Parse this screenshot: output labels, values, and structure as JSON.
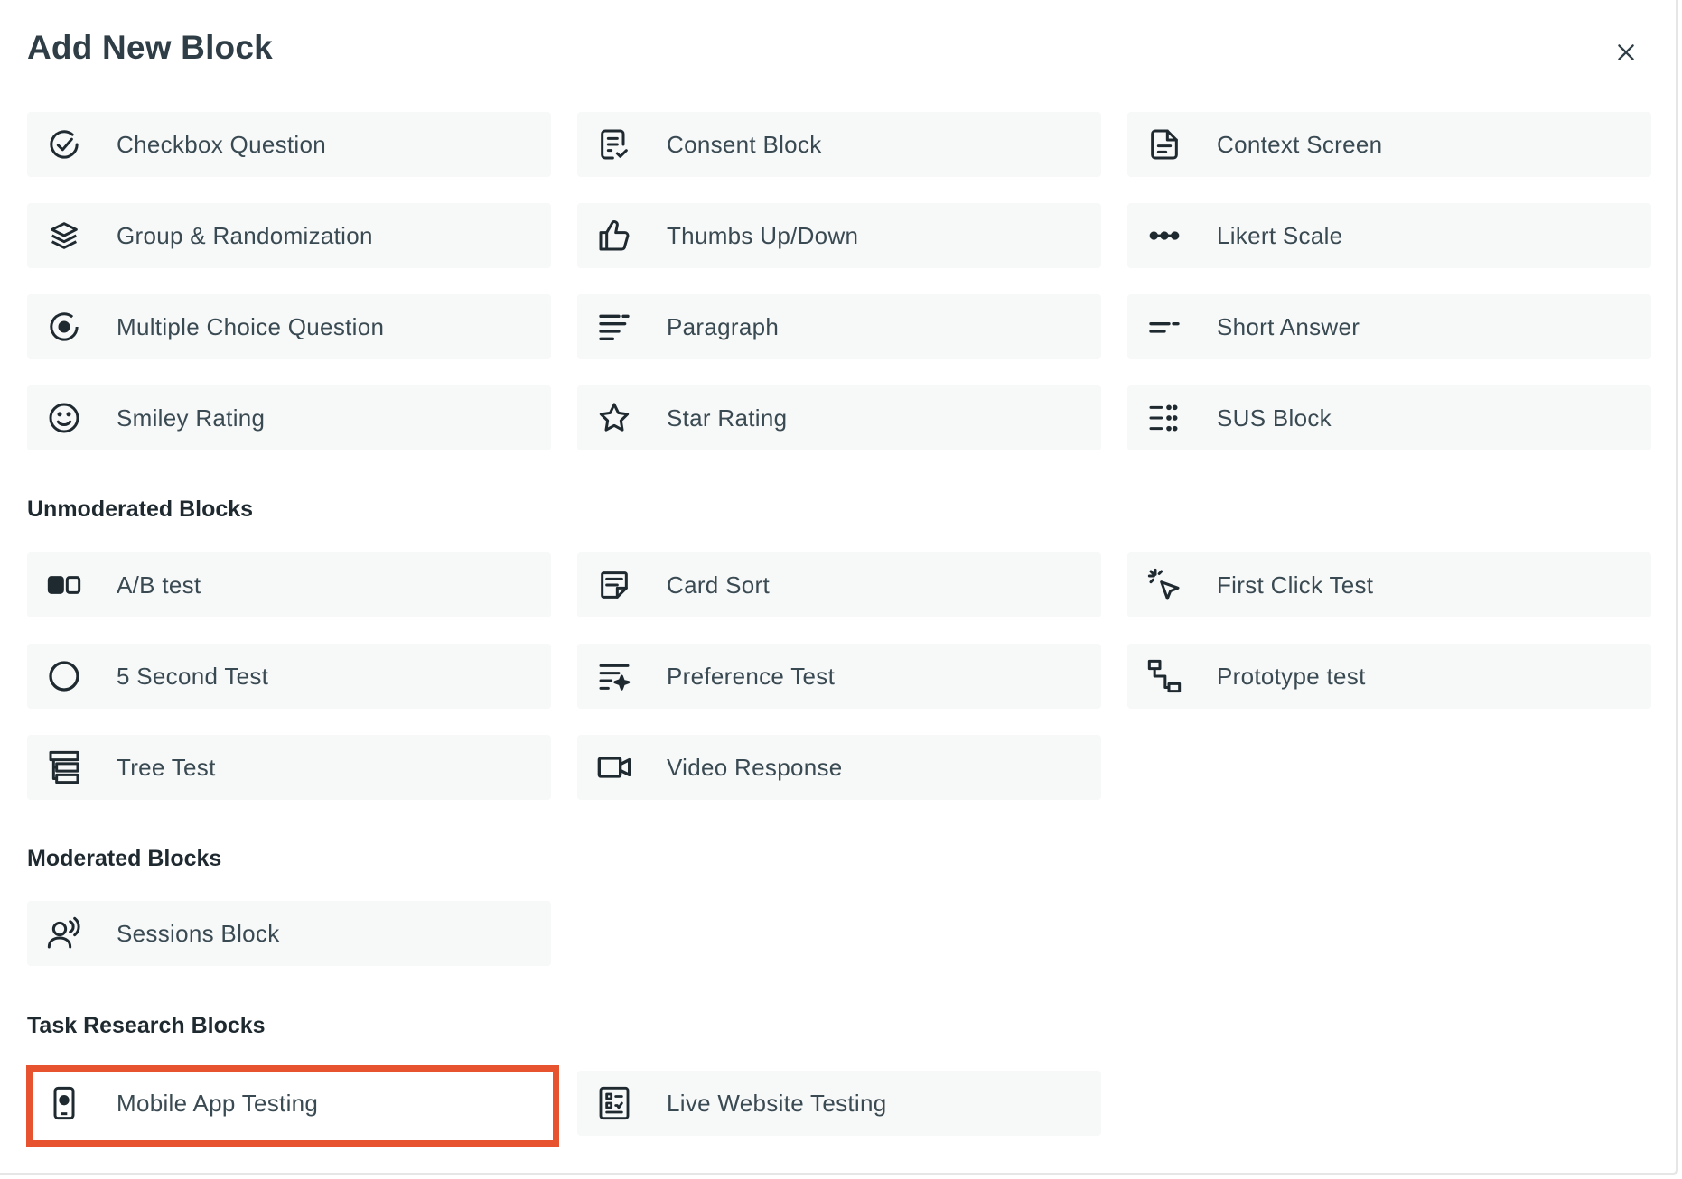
{
  "modal": {
    "title": "Add New Block",
    "close_icon": "close-icon"
  },
  "sections": {
    "general": {
      "items": [
        {
          "label": "Checkbox Question",
          "icon": "check-circle-icon"
        },
        {
          "label": "Consent Block",
          "icon": "document-check-icon"
        },
        {
          "label": "Context Screen",
          "icon": "file-text-icon"
        },
        {
          "label": "Group & Randomization",
          "icon": "layers-icon"
        },
        {
          "label": "Thumbs Up/Down",
          "icon": "thumbs-up-icon"
        },
        {
          "label": "Likert Scale",
          "icon": "dots-line-icon"
        },
        {
          "label": "Multiple Choice Question",
          "icon": "radio-icon"
        },
        {
          "label": "Paragraph",
          "icon": "paragraph-icon"
        },
        {
          "label": "Short Answer",
          "icon": "short-answer-icon"
        },
        {
          "label": "Smiley Rating",
          "icon": "smiley-icon"
        },
        {
          "label": "Star Rating",
          "icon": "star-icon"
        },
        {
          "label": "SUS Block",
          "icon": "list-dots-icon"
        }
      ]
    },
    "unmoderated": {
      "title": "Unmoderated Blocks",
      "items": [
        {
          "label": "A/B test",
          "icon": "ab-test-icon"
        },
        {
          "label": "Card Sort",
          "icon": "card-sort-icon"
        },
        {
          "label": "First Click Test",
          "icon": "cursor-click-icon"
        },
        {
          "label": "5 Second Test",
          "icon": "circle-icon"
        },
        {
          "label": "Preference Test",
          "icon": "preference-icon"
        },
        {
          "label": "Prototype test",
          "icon": "flow-icon"
        },
        {
          "label": "Tree Test",
          "icon": "tree-icon"
        },
        {
          "label": "Video Response",
          "icon": "video-icon"
        }
      ]
    },
    "moderated": {
      "title": "Moderated Blocks",
      "items": [
        {
          "label": "Sessions Block",
          "icon": "user-voice-icon"
        }
      ]
    },
    "task_research": {
      "title": "Task Research Blocks",
      "items": [
        {
          "label": "Mobile App Testing",
          "icon": "mobile-icon"
        },
        {
          "label": "Live Website Testing",
          "icon": "checklist-icon"
        }
      ]
    }
  },
  "colors": {
    "highlight": "#e8532f",
    "tile_bg": "#f7f8f8",
    "text": "#3a4a52",
    "icon": "#1f2a30"
  }
}
